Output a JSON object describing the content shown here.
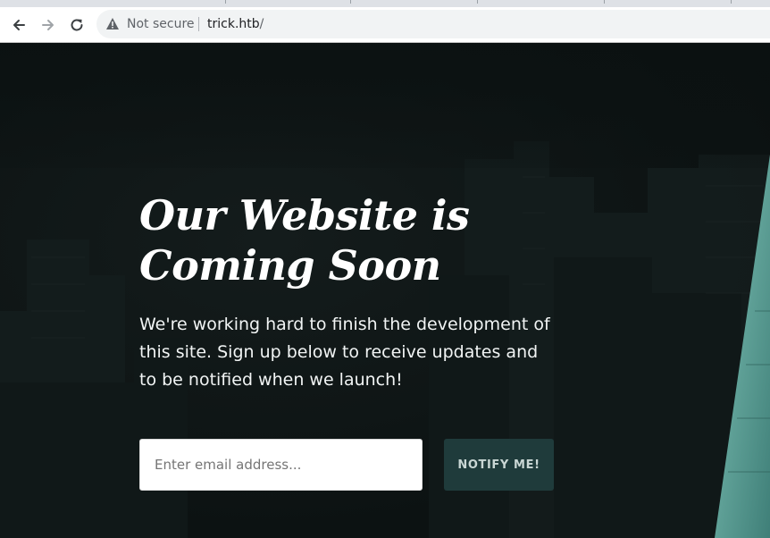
{
  "browser": {
    "security_label": "Not secure",
    "url_host": "trick.htb",
    "url_path": "/",
    "icons": {
      "back": "arrow-left-icon",
      "forward": "arrow-right-icon",
      "reload": "reload-icon",
      "warning": "warning-triangle-icon"
    }
  },
  "hero": {
    "title_line1": "Our Website is",
    "title_line2": "Coming Soon",
    "description": "We're working hard to finish the development of this site. Sign up below to receive updates and to be notified when we launch!"
  },
  "signup": {
    "email_placeholder": "Enter email address...",
    "email_value": "",
    "button_label": "NOTIFY ME!"
  },
  "colors": {
    "page_background": "#0d1414",
    "accent_button": "#1f3b3b",
    "button_text": "#c9d6d4",
    "teal_edge": "#5fa8a0"
  }
}
